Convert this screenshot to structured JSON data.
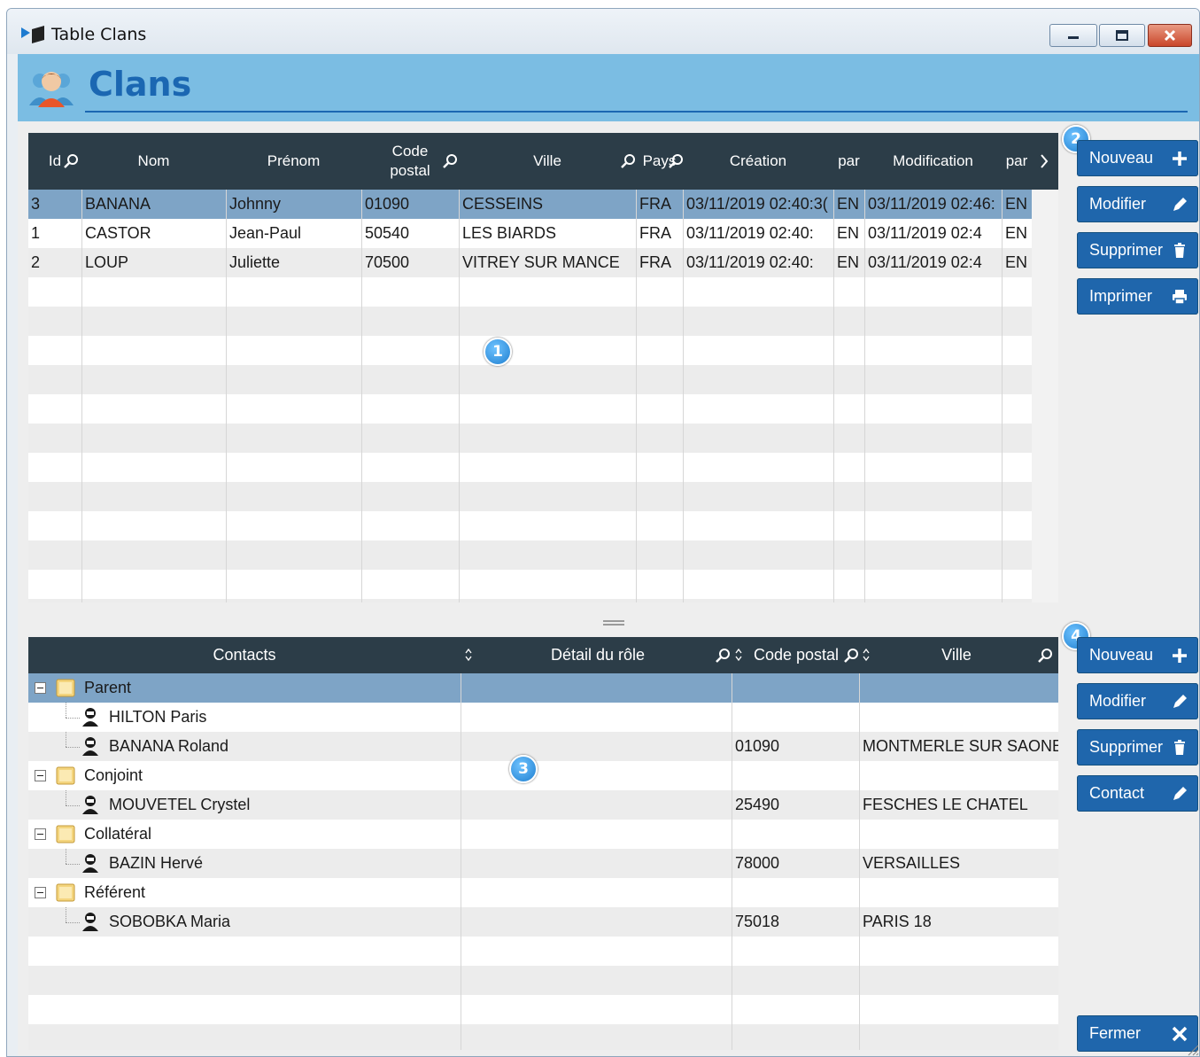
{
  "window": {
    "title": "Table Clans",
    "icon": "arrow-flag-icon"
  },
  "header": {
    "title": "Clans",
    "icon": "group-people-icon",
    "accent": "#1b67b2",
    "band_color": "#7bbde3"
  },
  "clans_table": {
    "columns": [
      "Id",
      "Nom",
      "Prénom",
      "Code postal",
      "Ville",
      "Pays",
      "Création",
      "par",
      "Modification",
      "par"
    ],
    "rows": [
      {
        "id": "3",
        "nom": "BANANA",
        "prenom": "Johnny",
        "cp": "01090",
        "ville": "CESSEINS",
        "pays": "FRA",
        "creation": "03/11/2019 02:40:3(",
        "par1": "EN",
        "modif": "03/11/2019 02:46:",
        "par2": "EN",
        "selected": true
      },
      {
        "id": "1",
        "nom": "CASTOR",
        "prenom": "Jean-Paul",
        "cp": "50540",
        "ville": "LES BIARDS",
        "pays": "FRA",
        "creation": "03/11/2019 02:40:",
        "par1": "EN",
        "modif": "03/11/2019 02:4",
        "par2": "EN",
        "selected": false
      },
      {
        "id": "2",
        "nom": "LOUP",
        "prenom": "Juliette",
        "cp": "70500",
        "ville": "VITREY SUR MANCE",
        "pays": "FRA",
        "creation": "03/11/2019 02:40:",
        "par1": "EN",
        "modif": "03/11/2019 02:4",
        "par2": "EN",
        "selected": false
      }
    ]
  },
  "clan_buttons": {
    "nouveau": "Nouveau",
    "modifier": "Modifier",
    "supprimer": "Supprimer",
    "imprimer": "Imprimer"
  },
  "contacts_table": {
    "columns": [
      "Contacts",
      "Détail du rôle",
      "Code postal",
      "Ville"
    ],
    "rows": [
      {
        "kind": "group",
        "label": "Parent",
        "cp": "",
        "ville": "",
        "selected": true
      },
      {
        "kind": "person",
        "label": "HILTON Paris",
        "cp": "",
        "ville": ""
      },
      {
        "kind": "person",
        "label": "BANANA Roland",
        "cp": "01090",
        "ville": "MONTMERLE SUR SAONE"
      },
      {
        "kind": "group",
        "label": "Conjoint",
        "cp": "",
        "ville": ""
      },
      {
        "kind": "person",
        "label": "MOUVETEL Crystel",
        "cp": "25490",
        "ville": "FESCHES LE CHATEL"
      },
      {
        "kind": "group",
        "label": "Collatéral",
        "cp": "",
        "ville": ""
      },
      {
        "kind": "person",
        "label": "BAZIN Hervé",
        "cp": "78000",
        "ville": "VERSAILLES"
      },
      {
        "kind": "group",
        "label": "Référent",
        "cp": "",
        "ville": ""
      },
      {
        "kind": "person",
        "label": "SOBOBKA Maria",
        "cp": "75018",
        "ville": "PARIS 18"
      }
    ]
  },
  "contact_buttons": {
    "nouveau": "Nouveau",
    "modifier": "Modifier",
    "supprimer": "Supprimer",
    "contact": "Contact",
    "fermer": "Fermer"
  },
  "badges": [
    "1",
    "2",
    "3",
    "4"
  ],
  "colors": {
    "grid_header": "#2c3d48",
    "selected_row": "#7ea4c6",
    "button": "#1f66ac",
    "badge": "#2a8de0"
  }
}
